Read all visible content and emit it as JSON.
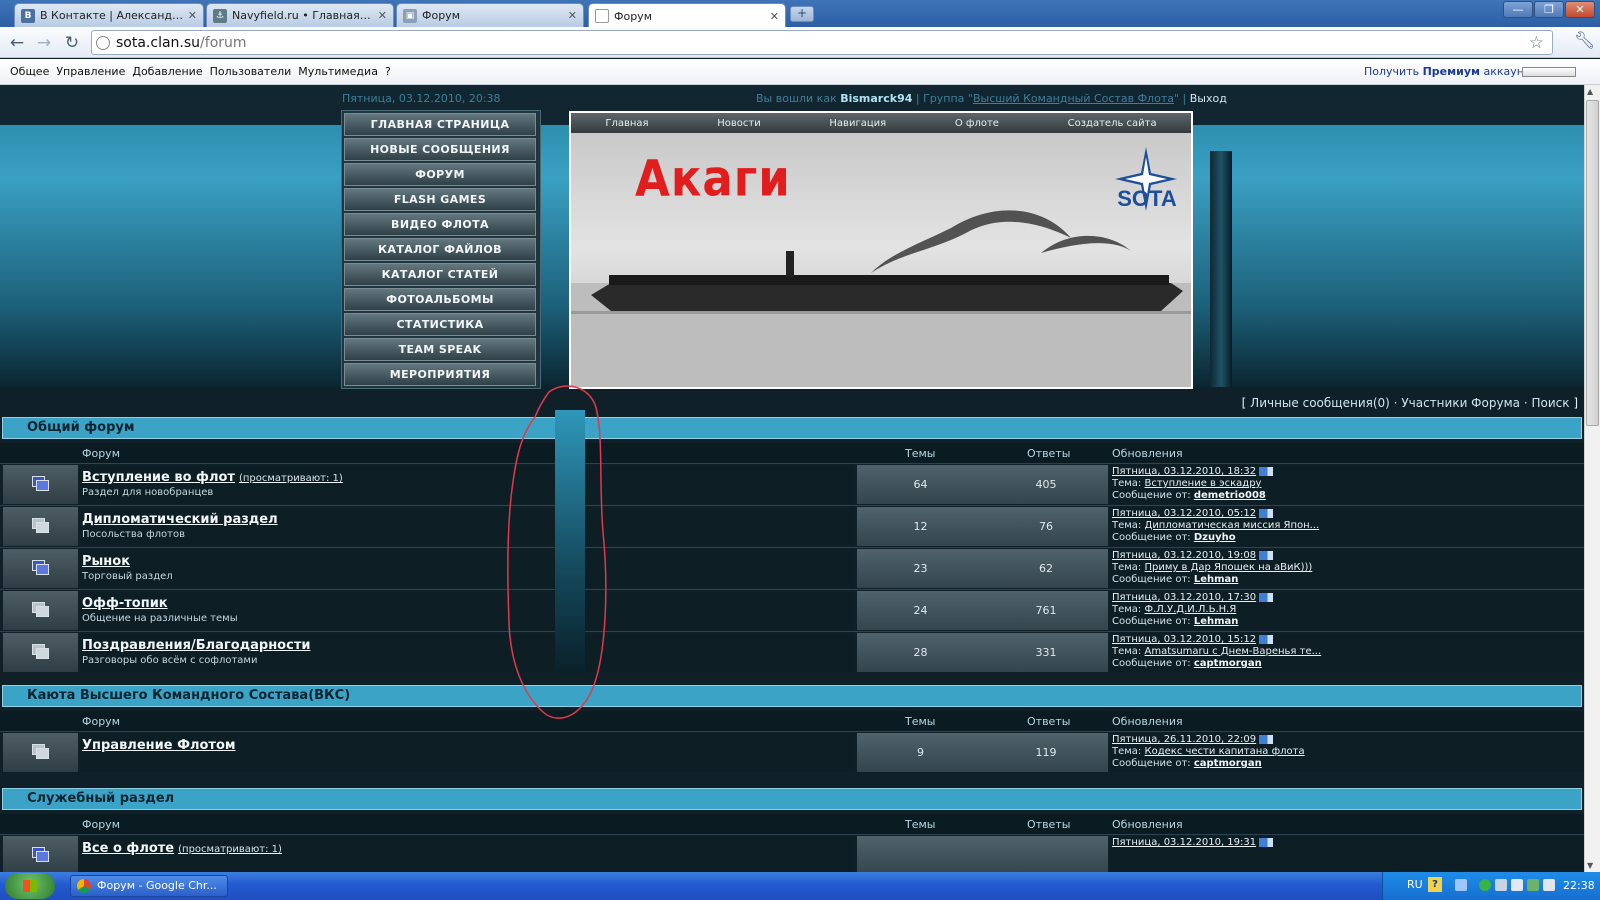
{
  "browser": {
    "tabs": [
      {
        "title": "В Контакте | Александр ...",
        "favicon": "vk-icon",
        "active": false
      },
      {
        "title": "Navyfield.ru • Главная ст...",
        "favicon": "navyfield-icon",
        "active": false
      },
      {
        "title": "Форум",
        "favicon": "forum-icon",
        "active": false
      },
      {
        "title": "Форум",
        "favicon": "page-icon",
        "active": true
      }
    ],
    "newtab_label": "+",
    "address_host": "sota.clan.su",
    "address_path": "/forum"
  },
  "ucozbar": {
    "menu": [
      "Общее",
      "Управление",
      "Добавление",
      "Пользователи",
      "Мультимедиа",
      "?"
    ],
    "premium_prefix": "Получить",
    "premium_bold": "Премиум",
    "premium_suffix": "аккаунт"
  },
  "site": {
    "date": "Пятница, 03.12.2010, 20:38",
    "logged_prefix": "Вы вошли как",
    "username": "Bismarck94",
    "group_prefix": "Группа \"",
    "group_name": "Высший Командный Состав Флота",
    "group_suffix": "\"",
    "logout": "Выход",
    "menu": [
      "ГЛАВНАЯ СТРАНИЦА",
      "НОВЫЕ СООБЩЕНИЯ",
      "ФОРУМ",
      "FLASH GAMES",
      "ВИДЕО ФЛОТА",
      "КАТАЛОГ ФАЙЛОВ",
      "КАТАЛОГ СТАТЕЙ",
      "ФОТОАЛЬБОМЫ",
      "СТАТИСТИКА",
      "TEAM SPEAK",
      "МЕРОПРИЯТИЯ"
    ],
    "header_nav": [
      "Главная",
      "Новости",
      "Навигация",
      "О флоте",
      "Создатель сайта"
    ],
    "ship_title": "Акаги",
    "logo_text": "SOTA",
    "right_links": {
      "open": "[",
      "pm": "Личные сообщения(0)",
      "sep": "·",
      "members": "Участники Форума",
      "search": "Поиск",
      "close": "]"
    }
  },
  "columns": {
    "forum": "Форум",
    "topics": "Темы",
    "replies": "Ответы",
    "updates": "Обновления"
  },
  "labels": {
    "topic_prefix": "Тема:",
    "msg_prefix": "Сообщение от:"
  },
  "sections": [
    {
      "title": "Общий форум",
      "rows": [
        {
          "title": "Вступление во флот",
          "viewers": "(просматривают: 1)",
          "desc": "Раздел для новобранцев",
          "topics": "64",
          "replies": "405",
          "last_date": "Пятница, 03.12.2010, 18:32",
          "last_topic": "Вступление в эскадру",
          "last_user": "demetrio008",
          "new": true
        },
        {
          "title": "Дипломатический раздел",
          "viewers": "",
          "desc": "Посольства флотов",
          "topics": "12",
          "replies": "76",
          "last_date": "Пятница, 03.12.2010, 05:12",
          "last_topic": "Дипломатическая миссия Япон...",
          "last_user": "Dzuyho",
          "new": false
        },
        {
          "title": "Рынок",
          "viewers": "",
          "desc": "Торговый раздел",
          "topics": "23",
          "replies": "62",
          "last_date": "Пятница, 03.12.2010, 19:08",
          "last_topic": "Приму в Дар Япошек на аВиК)))",
          "last_user": "Lehman",
          "new": true
        },
        {
          "title": "Офф-топик",
          "viewers": "",
          "desc": "Общение на различные темы",
          "topics": "24",
          "replies": "761",
          "last_date": "Пятница, 03.12.2010, 17:30",
          "last_topic": "Ф.Л.У.Д.И.Л.Ь.Н.Я",
          "last_user": "Lehman",
          "new": false
        },
        {
          "title": "Поздравления/Благодарности",
          "viewers": "",
          "desc": "Разговоры обо всём с софлотами",
          "topics": "28",
          "replies": "331",
          "last_date": "Пятница, 03.12.2010, 15:12",
          "last_topic": "Amatsumaru с Днем-Варенья те...",
          "last_user": "captmorgan",
          "new": false
        }
      ]
    },
    {
      "title": "Каюта Высшего Командного Состава(ВКС)",
      "rows": [
        {
          "title": "Управление Флотом",
          "viewers": "",
          "desc": "",
          "topics": "9",
          "replies": "119",
          "last_date": "Пятница, 26.11.2010, 22:09",
          "last_topic": "Кодекс чести капитана флота",
          "last_user": "captmorgan",
          "new": false
        }
      ]
    },
    {
      "title": "Служебный раздел",
      "rows": [
        {
          "title": "Все о флоте",
          "viewers": "(просматривают: 1)",
          "desc": "",
          "topics": "",
          "replies": "",
          "last_date": "Пятница, 03.12.2010, 19:31",
          "last_topic": "",
          "last_user": "",
          "new": true
        }
      ]
    }
  ],
  "taskbar": {
    "task_label": "Форум - Google Chr...",
    "lang": "RU",
    "help": "?",
    "clock": "22:38"
  }
}
